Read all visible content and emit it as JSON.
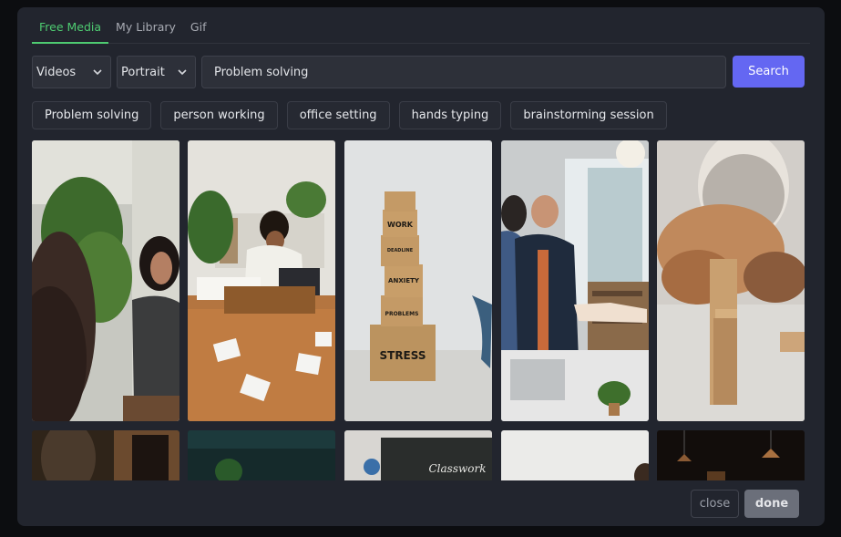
{
  "tabs": [
    {
      "label": "Free Media",
      "active": true
    },
    {
      "label": "My Library",
      "active": false
    },
    {
      "label": "Gif",
      "active": false
    }
  ],
  "controls": {
    "media_type": "Videos",
    "orientation": "Portrait",
    "search_value": "Problem solving",
    "search_button": "Search"
  },
  "suggestions": [
    "Problem solving",
    "person working",
    "office setting",
    "hands typing",
    "brainstorming session"
  ],
  "thumbnails": [
    {
      "name": "woman-stressed-by-plant",
      "text": ""
    },
    {
      "name": "woman-messy-desk-papers",
      "text": ""
    },
    {
      "name": "stress-box-tower",
      "labels": [
        "WORK",
        "DEADLINE",
        "ANXIETY",
        "PROBLEMS",
        "STRESS"
      ]
    },
    {
      "name": "office-handshake",
      "text": ""
    },
    {
      "name": "wooden-blocks-domino",
      "text": ""
    },
    {
      "name": "dark-room-video",
      "text": ""
    },
    {
      "name": "teal-plant-video",
      "text": ""
    },
    {
      "name": "classwork-chalkboard",
      "text": "Classwork"
    },
    {
      "name": "white-wall-video",
      "text": ""
    },
    {
      "name": "dark-pendant-lamps",
      "text": ""
    }
  ],
  "footer": {
    "close_label": "close",
    "done_label": "done"
  },
  "colors": {
    "accent_green": "#4ecb71",
    "search_button": "#6467f2",
    "modal_bg": "#22252e"
  }
}
